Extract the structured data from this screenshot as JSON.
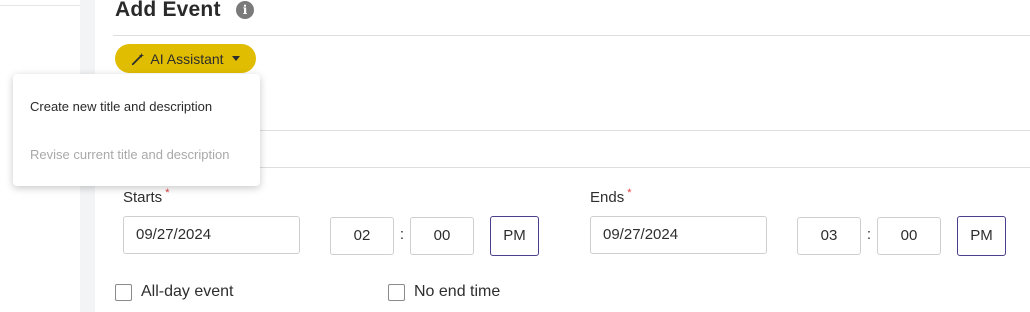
{
  "header": {
    "title": "Add Event",
    "info_icon": "info-icon"
  },
  "ai_assistant": {
    "label": "AI Assistant",
    "icon": "magic-wand-icon",
    "button_color": "#e0bd00"
  },
  "ai_menu": {
    "items": [
      {
        "label": "Create new title and description",
        "enabled": true
      },
      {
        "label": "Revise current title and description",
        "enabled": false
      }
    ]
  },
  "starts": {
    "label": "Starts",
    "required_mark": "*",
    "date": "09/27/2024",
    "hour": "02",
    "minute": "00",
    "separator": ":",
    "ampm": "PM"
  },
  "ends": {
    "label": "Ends",
    "required_mark": "*",
    "date": "09/27/2024",
    "hour": "03",
    "minute": "00",
    "separator": ":",
    "ampm": "PM"
  },
  "options": {
    "all_day_label": "All-day event",
    "all_day_checked": false,
    "no_end_label": "No end time",
    "no_end_checked": false
  }
}
